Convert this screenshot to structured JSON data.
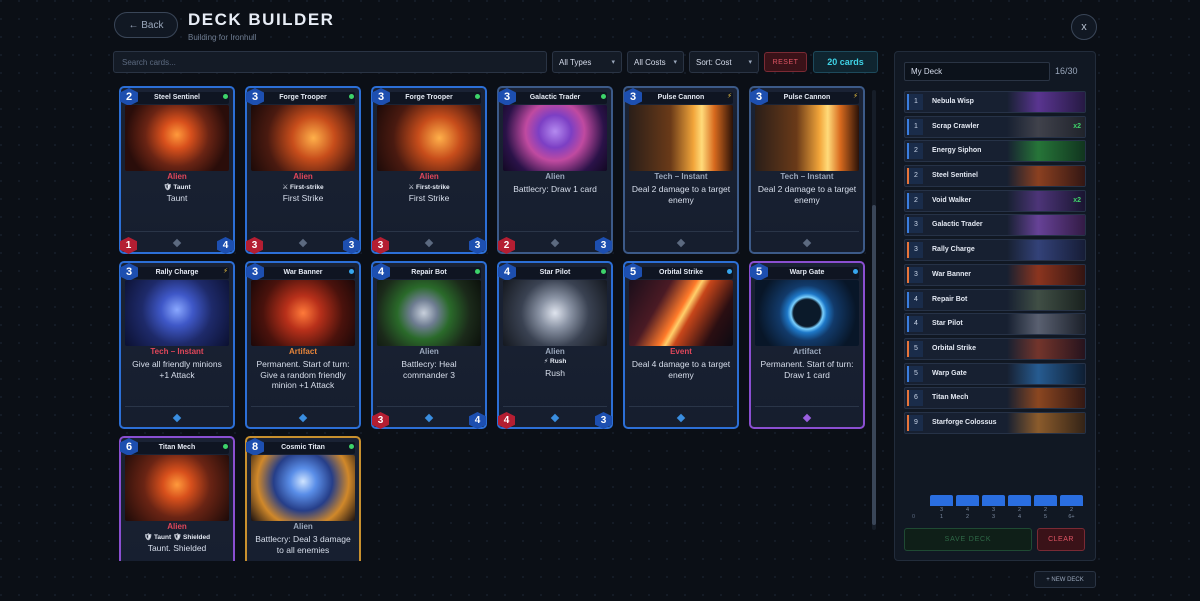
{
  "header": {
    "back_label": "← Back",
    "title": "DECK BUILDER",
    "subtitle": "Building for Ironhull",
    "close_label": "x"
  },
  "toolbar": {
    "search_placeholder": "Search cards...",
    "type_filter": "All Types",
    "cost_filter": "All Costs",
    "sort": "Sort: Cost",
    "reset_label": "RESET",
    "count_label": "20 cards"
  },
  "cards": [
    {
      "name": "Steel Sentinel",
      "cost": "2",
      "type": "Alien",
      "keyword": "🛡 Taunt",
      "desc": "Taunt",
      "atk": "1",
      "hp": "4"
    },
    {
      "name": "Forge Trooper",
      "cost": "3",
      "type": "Alien",
      "keyword": "⚔ First-strike",
      "desc": "First Strike",
      "atk": "3",
      "hp": "3"
    },
    {
      "name": "Forge Trooper",
      "cost": "3",
      "type": "Alien",
      "keyword": "⚔ First-strike",
      "desc": "First Strike",
      "atk": "3",
      "hp": "3"
    },
    {
      "name": "Galactic Trader",
      "cost": "3",
      "type": "Alien",
      "desc": "Battlecry: Draw 1 card",
      "atk": "2",
      "hp": "3"
    },
    {
      "name": "Pulse Cannon",
      "cost": "3",
      "type": "Tech – Instant",
      "desc": "Deal 2 damage to a target enemy"
    },
    {
      "name": "Pulse Cannon",
      "cost": "3",
      "type": "Tech – Instant",
      "desc": "Deal 2 damage to a target enemy"
    },
    {
      "name": "Rally Charge",
      "cost": "3",
      "type": "Tech – Instant",
      "desc": "Give all friendly minions +1 Attack"
    },
    {
      "name": "War Banner",
      "cost": "3",
      "type": "Artifact",
      "desc": "Permanent. Start of turn: Give a random friendly minion +1 Attack"
    },
    {
      "name": "Repair Bot",
      "cost": "4",
      "type": "Alien",
      "desc": "Battlecry: Heal commander 3",
      "atk": "3",
      "hp": "4"
    },
    {
      "name": "Star Pilot",
      "cost": "4",
      "type": "Alien",
      "keyword": "⚡ Rush",
      "desc": "Rush",
      "atk": "4",
      "hp": "3"
    },
    {
      "name": "Orbital Strike",
      "cost": "5",
      "type": "Event",
      "desc": "Deal 4 damage to a target enemy"
    },
    {
      "name": "Warp Gate",
      "cost": "5",
      "type": "Artifact",
      "desc": "Permanent. Start of turn: Draw 1 card"
    },
    {
      "name": "Titan Mech",
      "cost": "6",
      "type": "Alien",
      "keyword": "🛡 Taunt  🛡 Shielded",
      "desc": "Taunt. Shielded"
    },
    {
      "name": "Cosmic Titan",
      "cost": "8",
      "type": "Alien",
      "desc": "Battlecry: Deal 3 damage to all enemies"
    }
  ],
  "deck": {
    "name": "My Deck",
    "count": "16/30",
    "items": [
      {
        "cost": "1",
        "name": "Nebula Wisp",
        "qty": ""
      },
      {
        "cost": "1",
        "name": "Scrap Crawler",
        "qty": "x2"
      },
      {
        "cost": "2",
        "name": "Energy Siphon",
        "qty": ""
      },
      {
        "cost": "2",
        "name": "Steel Sentinel",
        "qty": ""
      },
      {
        "cost": "2",
        "name": "Void Walker",
        "qty": "x2"
      },
      {
        "cost": "3",
        "name": "Galactic Trader",
        "qty": ""
      },
      {
        "cost": "3",
        "name": "Rally Charge",
        "qty": ""
      },
      {
        "cost": "3",
        "name": "War Banner",
        "qty": ""
      },
      {
        "cost": "4",
        "name": "Repair Bot",
        "qty": ""
      },
      {
        "cost": "4",
        "name": "Star Pilot",
        "qty": ""
      },
      {
        "cost": "5",
        "name": "Orbital Strike",
        "qty": ""
      },
      {
        "cost": "5",
        "name": "Warp Gate",
        "qty": ""
      },
      {
        "cost": "6",
        "name": "Titan Mech",
        "qty": ""
      },
      {
        "cost": "9",
        "name": "Starforge Colossus",
        "qty": ""
      }
    ],
    "curve": {
      "zero_label": "0",
      "counts": [
        "3",
        "4",
        "3",
        "2",
        "2",
        "2"
      ],
      "labels": [
        "1",
        "2",
        "3",
        "4",
        "5",
        "6+"
      ]
    },
    "save_label": "SAVE DECK",
    "clear_label": "CLEAR",
    "new_deck_label": "+ NEW DECK"
  },
  "colors": {
    "accent": "#2c6fd6",
    "danger": "#e05565",
    "count": "#3fd3e6",
    "rare_border": "#2c6fd6",
    "epic_border": "#8a4fd1",
    "legendary_border": "#c8902e"
  }
}
